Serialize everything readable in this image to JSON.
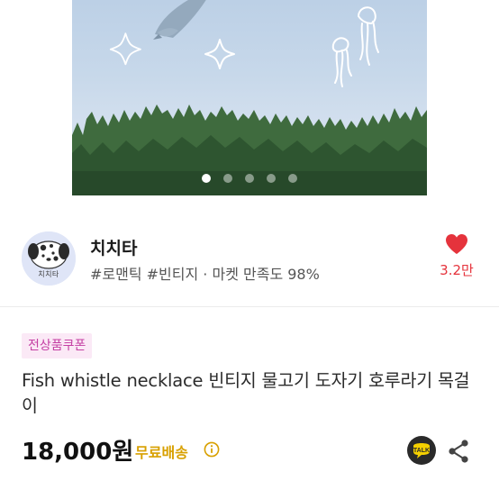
{
  "gallery": {
    "image_count": 5,
    "active_index": 0
  },
  "shop": {
    "name": "치치타",
    "avatar_text": "치치타",
    "meta": "#로맨틱 #빈티지 · 마켓 만족도 98%",
    "like_count": "3.2만"
  },
  "product": {
    "coupon_label": "전상품쿠폰",
    "title": "Fish whistle necklace 빈티지 물고기 도자기 호루라기 목걸이",
    "price": "18,000원",
    "shipping": "무료배송",
    "talk_label": "TALK"
  },
  "colors": {
    "like": "#e5333c",
    "coupon_bg": "#fbe9f6",
    "coupon_text": "#c43fa3",
    "shipping": "#d8a000",
    "talk_bg": "#2a2a2a",
    "talk_text": "#f5d000"
  },
  "icons": {
    "like": "heart-icon",
    "info": "info-icon",
    "talk": "talk-chat-icon",
    "share": "share-icon"
  }
}
